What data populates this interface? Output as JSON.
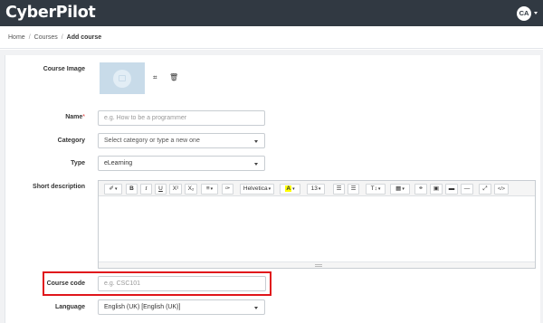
{
  "app": {
    "logo_text": "CyberPilot",
    "user_initials": "CA"
  },
  "breadcrumb": {
    "home": "Home",
    "courses": "Courses",
    "current": "Add course"
  },
  "form": {
    "course_image": {
      "label": "Course Image"
    },
    "name": {
      "label": "Name",
      "required_mark": "*",
      "placeholder": "e.g. How to be a programmer"
    },
    "category": {
      "label": "Category",
      "value": "Select category or type a new one"
    },
    "type": {
      "label": "Type",
      "value": "eLearning"
    },
    "short_description": {
      "label": "Short description"
    },
    "course_code": {
      "label": "Course code",
      "placeholder": "e.g. CSC101"
    },
    "language": {
      "label": "Language",
      "value": "English (UK) [English (UK)]"
    }
  },
  "editor_toolbar": {
    "style": "✐",
    "bold": "B",
    "italic": "I",
    "underline": "U",
    "superscript": "X²",
    "subscript": "X₂",
    "align": "≡",
    "eraser": "✑",
    "font_name": "Helvetica",
    "color": "A",
    "font_size": "13",
    "ul": "☰",
    "ol": "☰",
    "line_height": "T↕",
    "table": "▦",
    "link": "⚭",
    "picture": "▣",
    "video": "▬",
    "hr": "—",
    "fullscreen": "⤢",
    "code": "</>"
  },
  "colors": {
    "topbar": "#313942",
    "highlight": "#e0161b",
    "image_placeholder": "#c8dbe9"
  }
}
